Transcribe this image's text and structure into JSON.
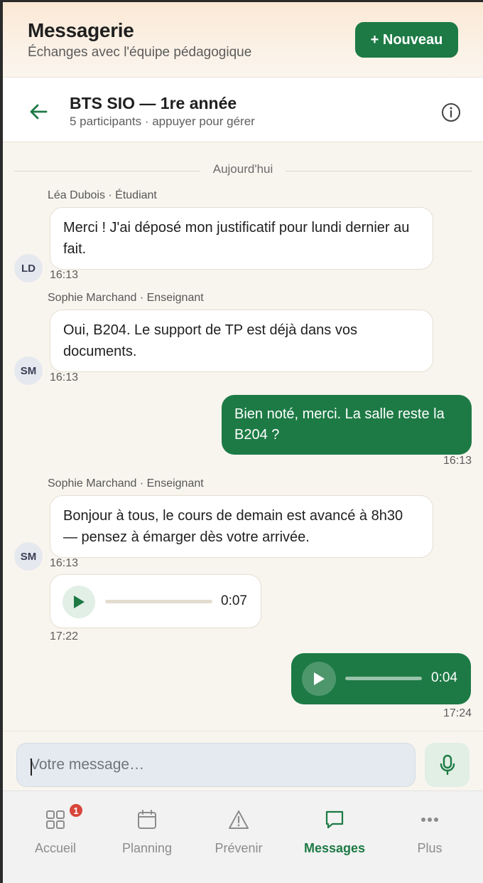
{
  "header": {
    "title": "Messagerie",
    "subtitle": "Échanges avec l'équipe pédagogique",
    "new_button": "+ Nouveau"
  },
  "conversation": {
    "title": "BTS SIO — 1re année",
    "subtitle": "5 participants · appuyer pour gérer",
    "back_icon": "arrow-left-icon",
    "info_icon": "info-icon"
  },
  "chat": {
    "day_separator": "Aujourd'hui",
    "messages": [
      {
        "sender": "Léa Dubois · Étudiant",
        "initials": "LD",
        "text": "Merci ! J'ai déposé mon justificatif pour lundi dernier au fait.",
        "time": "16:13",
        "direction": "in"
      },
      {
        "sender": "Sophie Marchand · Enseignant",
        "initials": "SM",
        "text": "Oui, B204. Le support de TP est déjà dans vos documents.",
        "time": "16:13",
        "direction": "in"
      },
      {
        "text": "Bien noté, merci. La salle reste la B204 ?",
        "time": "16:13",
        "direction": "out"
      },
      {
        "sender": "Sophie Marchand · Enseignant",
        "initials": "SM",
        "text": "Bonjour à tous, le cours de demain est avancé à 8h30 — pensez à émarger dès votre arrivée.",
        "time": "16:13",
        "direction": "in"
      },
      {
        "type": "audio",
        "duration": "0:07",
        "time": "17:22",
        "direction": "in",
        "progress": 0
      },
      {
        "type": "audio",
        "duration": "0:04",
        "time": "17:24",
        "direction": "out",
        "progress": 0
      }
    ]
  },
  "composer": {
    "placeholder": "Votre message…",
    "mic_icon": "microphone-icon"
  },
  "nav": {
    "items": [
      {
        "label": "Accueil",
        "icon": "grid-icon",
        "badge": "1"
      },
      {
        "label": "Planning",
        "icon": "calendar-icon"
      },
      {
        "label": "Prévenir",
        "icon": "warning-icon"
      },
      {
        "label": "Messages",
        "icon": "chat-icon",
        "active": true
      },
      {
        "label": "Plus",
        "icon": "more-icon"
      }
    ]
  },
  "colors": {
    "accent": "#1d7a45",
    "badge": "#d8453a"
  }
}
